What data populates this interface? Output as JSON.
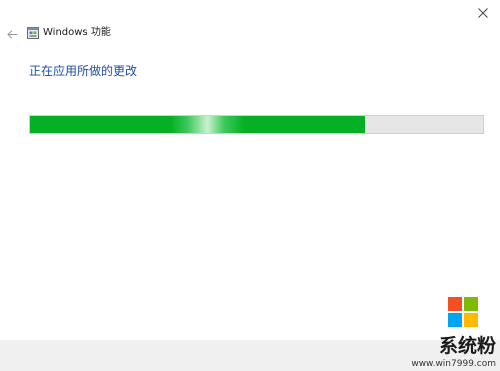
{
  "window": {
    "title": "Windows 功能",
    "close_glyph": "✕",
    "back_icon": "arrow-left-icon",
    "title_icon": "windows-features-icon"
  },
  "main": {
    "heading": "正在应用所做的更改",
    "progress": {
      "fraction": 0.74,
      "fill_color": "#06b025",
      "track_color": "#e6e6e6"
    }
  },
  "watermark": {
    "brand": "系统粉",
    "url": "www.win7999.com",
    "logo_colors": [
      "#f25022",
      "#7fba00",
      "#00a4ef",
      "#ffb900"
    ]
  }
}
